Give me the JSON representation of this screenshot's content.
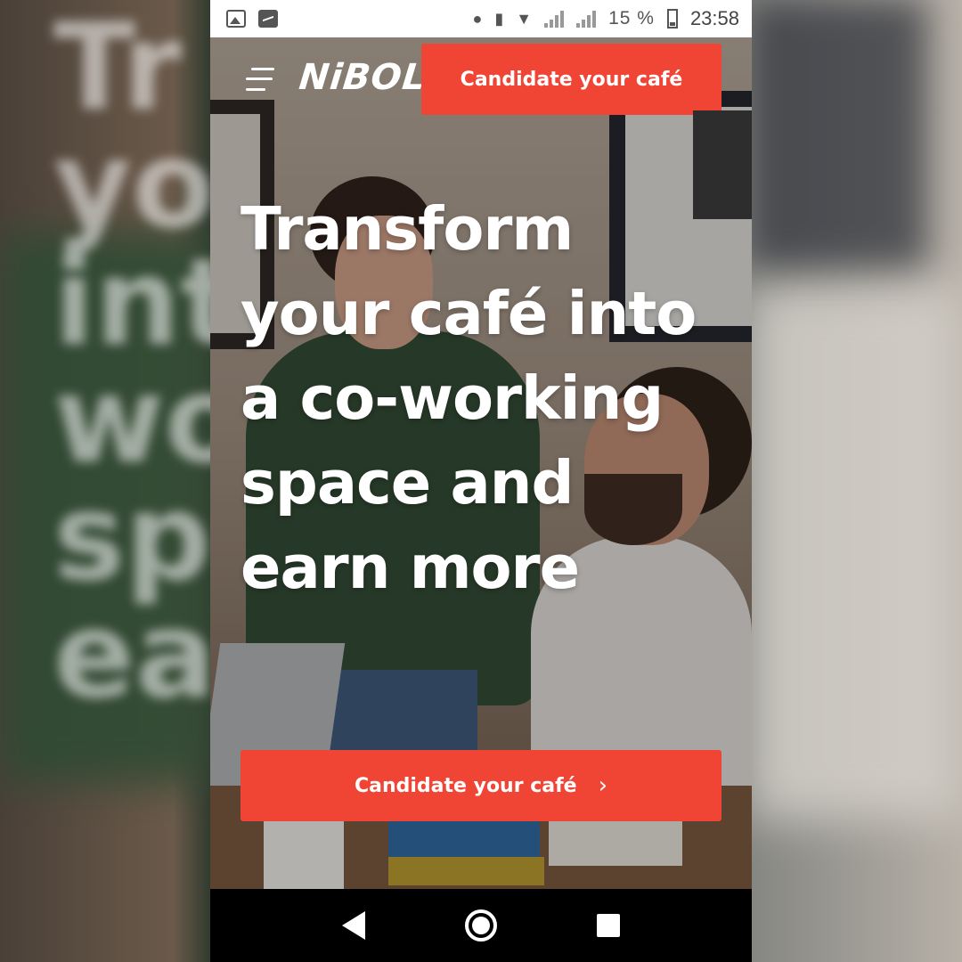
{
  "status_bar": {
    "battery_text": "15 %",
    "time": "23:58",
    "icons": [
      "image-icon",
      "activity-icon",
      "location-icon",
      "vibrate-icon",
      "wifi-icon",
      "signal-x-icon",
      "signal-icon",
      "battery-charging-icon"
    ]
  },
  "header": {
    "logo": "NiBOL",
    "menu_icon": "hamburger-icon",
    "cta_label": "Candidate your café"
  },
  "hero": {
    "headline": "Transform your café into a co-working space and earn more",
    "cta_label": "Candidate your café",
    "cta_icon": "chevron-right-icon"
  },
  "nav_bar": {
    "icons": [
      "back-icon",
      "home-icon",
      "recents-icon"
    ]
  },
  "colors": {
    "accent": "#f04434",
    "status_bar_bg": "#ffffff",
    "nav_bar_bg": "#000000"
  }
}
